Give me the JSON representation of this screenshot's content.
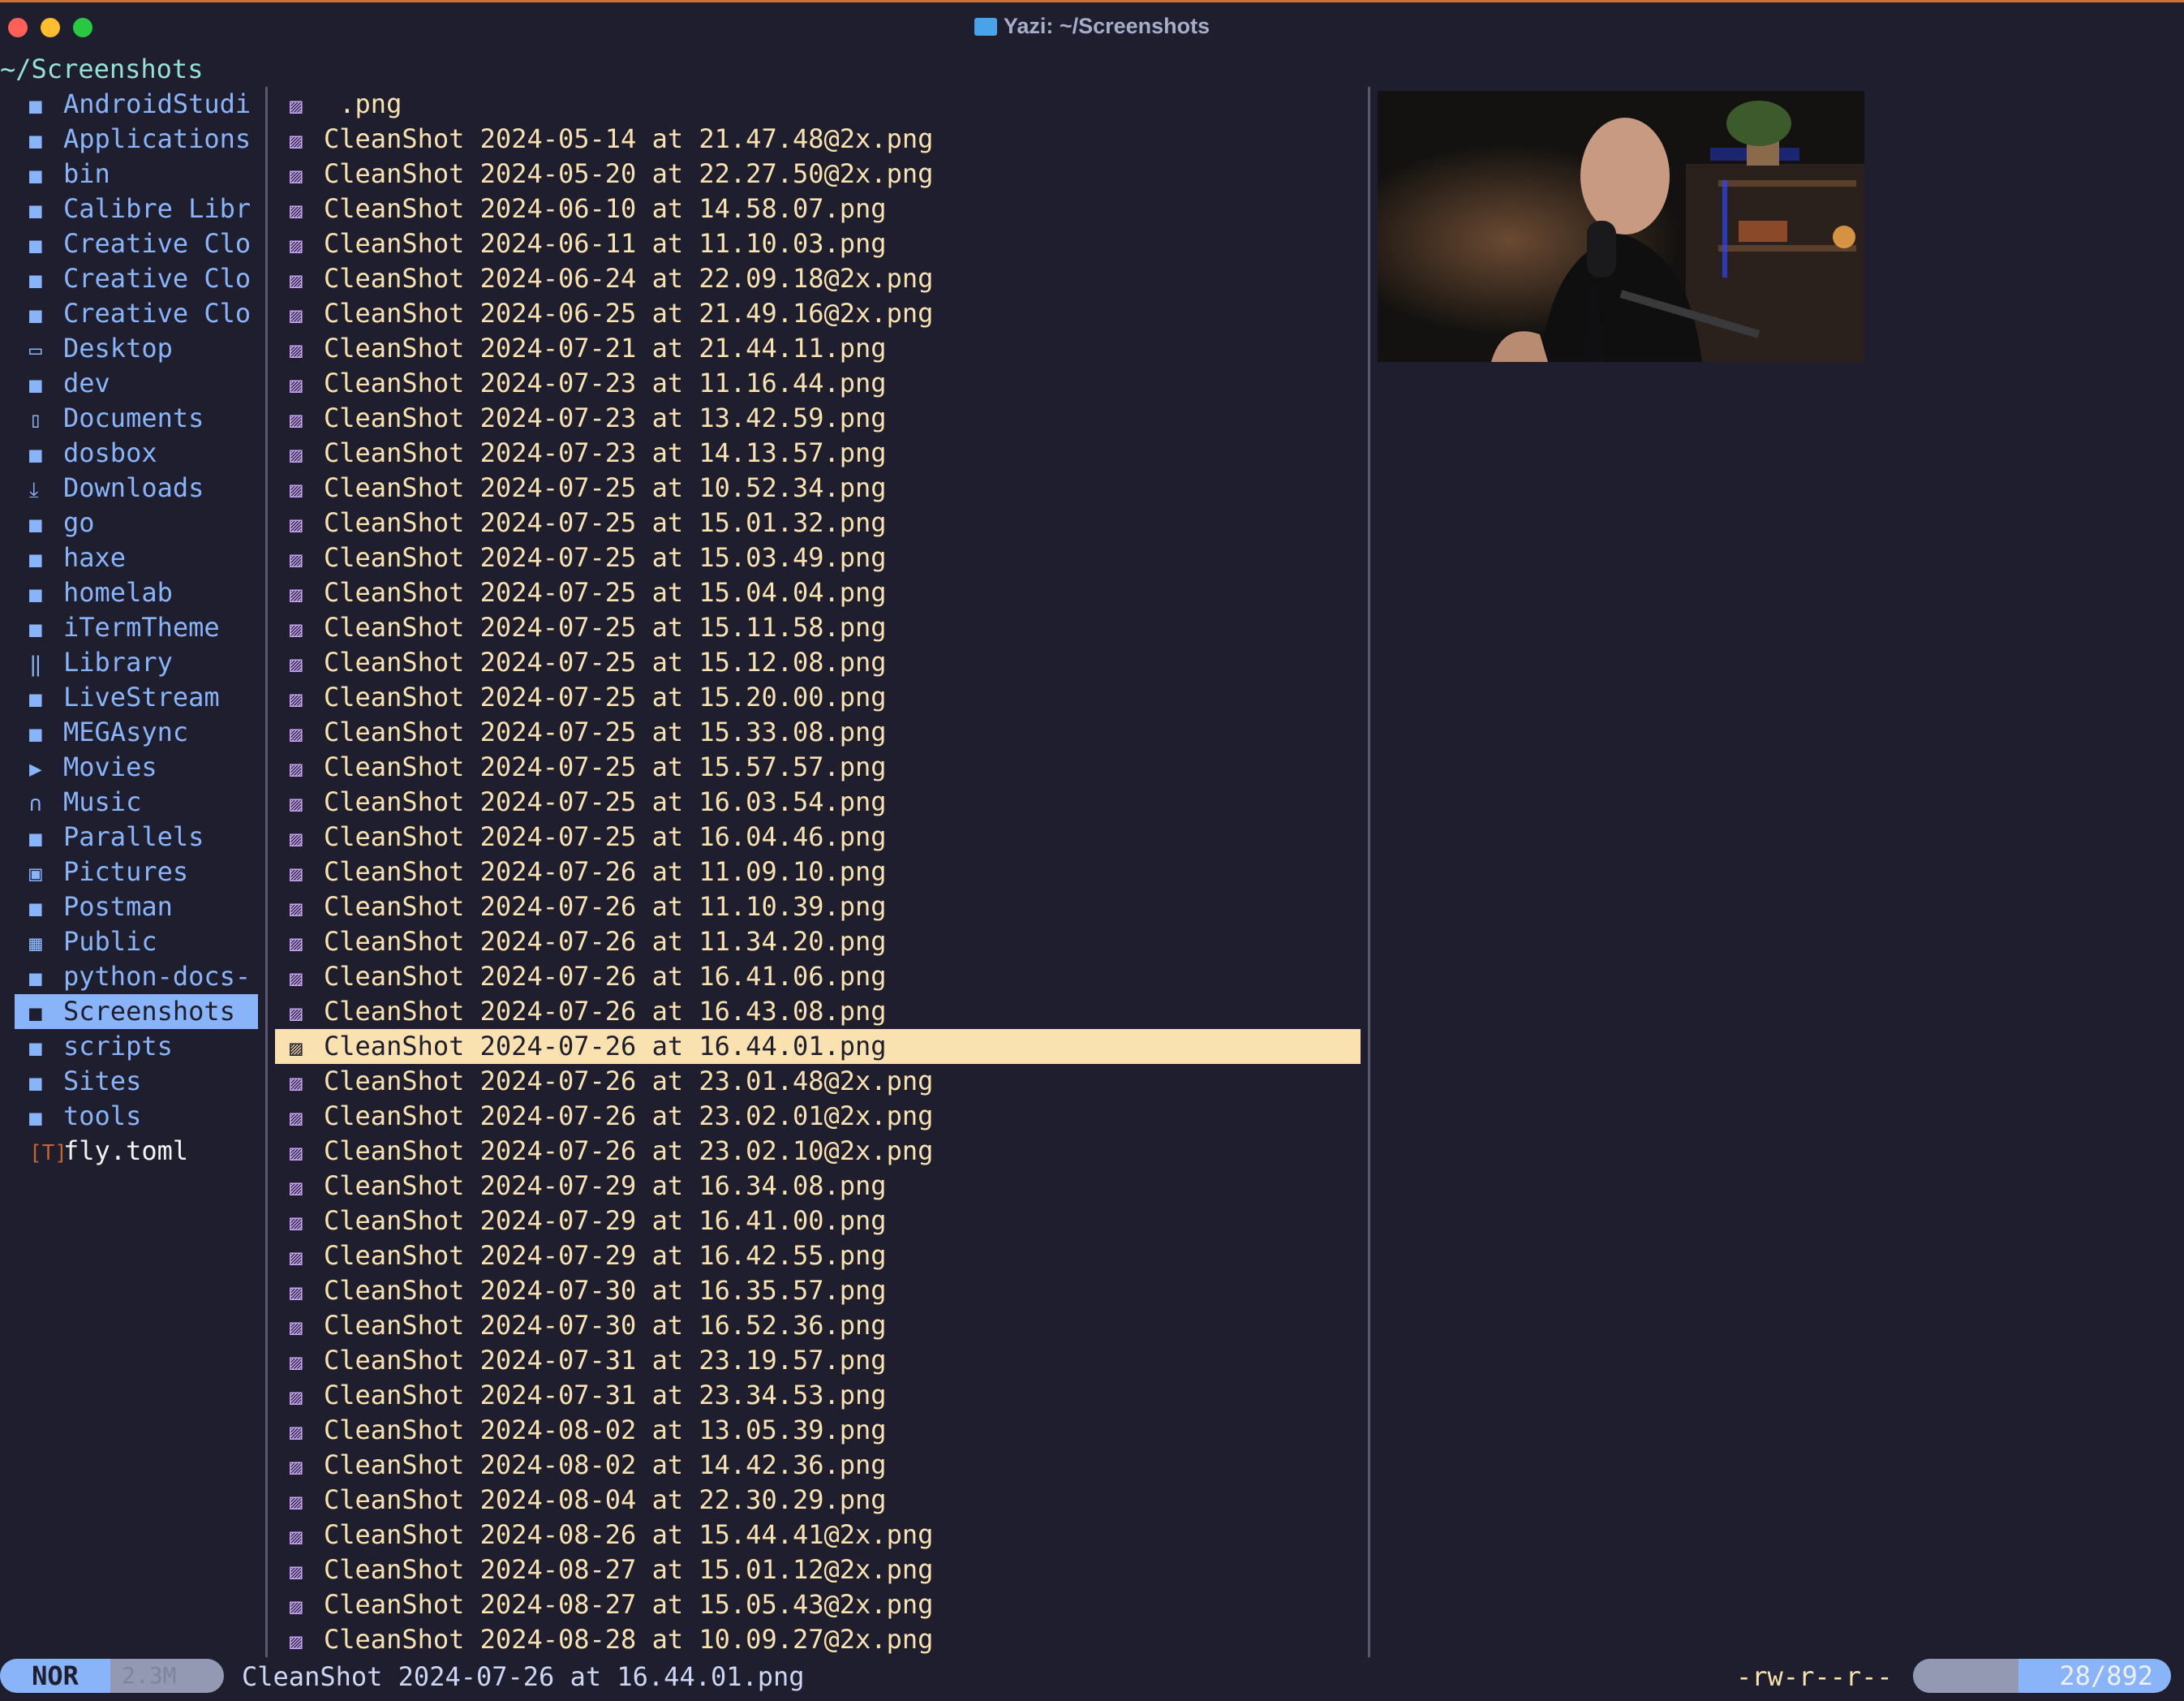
{
  "window": {
    "title": "Yazi: ~/Screenshots"
  },
  "cwd": "~/Screenshots",
  "sidebar": {
    "items": [
      {
        "label": "AndroidStudi",
        "icon": "folder-icon"
      },
      {
        "label": "Applications",
        "icon": "folder-icon"
      },
      {
        "label": "bin",
        "icon": "folder-icon"
      },
      {
        "label": "Calibre Libr",
        "icon": "folder-icon"
      },
      {
        "label": "Creative Clo",
        "icon": "folder-icon"
      },
      {
        "label": "Creative Clo",
        "icon": "folder-icon"
      },
      {
        "label": "Creative Clo",
        "icon": "folder-icon"
      },
      {
        "label": "Desktop",
        "icon": "desktop-icon"
      },
      {
        "label": "dev",
        "icon": "folder-icon"
      },
      {
        "label": "Documents",
        "icon": "documents-icon"
      },
      {
        "label": "dosbox",
        "icon": "folder-icon"
      },
      {
        "label": "Downloads",
        "icon": "downloads-icon"
      },
      {
        "label": "go",
        "icon": "folder-icon"
      },
      {
        "label": "haxe",
        "icon": "folder-icon"
      },
      {
        "label": "homelab",
        "icon": "folder-icon"
      },
      {
        "label": "iTermTheme",
        "icon": "folder-icon"
      },
      {
        "label": "Library",
        "icon": "library-icon"
      },
      {
        "label": "LiveStream",
        "icon": "folder-icon"
      },
      {
        "label": "MEGAsync",
        "icon": "folder-icon"
      },
      {
        "label": "Movies",
        "icon": "movies-icon"
      },
      {
        "label": "Music",
        "icon": "headphones-icon"
      },
      {
        "label": "Parallels",
        "icon": "folder-icon"
      },
      {
        "label": "Pictures",
        "icon": "pictures-icon"
      },
      {
        "label": "Postman",
        "icon": "folder-icon"
      },
      {
        "label": "Public",
        "icon": "public-icon"
      },
      {
        "label": "python-docs-",
        "icon": "folder-icon"
      },
      {
        "label": "Screenshots",
        "icon": "folder-icon",
        "selected": true
      },
      {
        "label": "scripts",
        "icon": "folder-icon"
      },
      {
        "label": "Sites",
        "icon": "folder-icon"
      },
      {
        "label": "tools",
        "icon": "folder-icon"
      },
      {
        "label": "fly.toml",
        "icon": "toml-file-icon",
        "file": true
      }
    ]
  },
  "files": {
    "selected_index": 27,
    "items": [
      " .png",
      "CleanShot 2024-05-14 at 21.47.48@2x.png",
      "CleanShot 2024-05-20 at 22.27.50@2x.png",
      "CleanShot 2024-06-10 at 14.58.07.png",
      "CleanShot 2024-06-11 at 11.10.03.png",
      "CleanShot 2024-06-24 at 22.09.18@2x.png",
      "CleanShot 2024-06-25 at 21.49.16@2x.png",
      "CleanShot 2024-07-21 at 21.44.11.png",
      "CleanShot 2024-07-23 at 11.16.44.png",
      "CleanShot 2024-07-23 at 13.42.59.png",
      "CleanShot 2024-07-23 at 14.13.57.png",
      "CleanShot 2024-07-25 at 10.52.34.png",
      "CleanShot 2024-07-25 at 15.01.32.png",
      "CleanShot 2024-07-25 at 15.03.49.png",
      "CleanShot 2024-07-25 at 15.04.04.png",
      "CleanShot 2024-07-25 at 15.11.58.png",
      "CleanShot 2024-07-25 at 15.12.08.png",
      "CleanShot 2024-07-25 at 15.20.00.png",
      "CleanShot 2024-07-25 at 15.33.08.png",
      "CleanShot 2024-07-25 at 15.57.57.png",
      "CleanShot 2024-07-25 at 16.03.54.png",
      "CleanShot 2024-07-25 at 16.04.46.png",
      "CleanShot 2024-07-26 at 11.09.10.png",
      "CleanShot 2024-07-26 at 11.10.39.png",
      "CleanShot 2024-07-26 at 11.34.20.png",
      "CleanShot 2024-07-26 at 16.41.06.png",
      "CleanShot 2024-07-26 at 16.43.08.png",
      "CleanShot 2024-07-26 at 16.44.01.png",
      "CleanShot 2024-07-26 at 23.01.48@2x.png",
      "CleanShot 2024-07-26 at 23.02.01@2x.png",
      "CleanShot 2024-07-26 at 23.02.10@2x.png",
      "CleanShot 2024-07-29 at 16.34.08.png",
      "CleanShot 2024-07-29 at 16.41.00.png",
      "CleanShot 2024-07-29 at 16.42.55.png",
      "CleanShot 2024-07-30 at 16.35.57.png",
      "CleanShot 2024-07-30 at 16.52.36.png",
      "CleanShot 2024-07-31 at 23.19.57.png",
      "CleanShot 2024-07-31 at 23.34.53.png",
      "CleanShot 2024-08-02 at 13.05.39.png",
      "CleanShot 2024-08-02 at 14.42.36.png",
      "CleanShot 2024-08-04 at 22.30.29.png",
      "CleanShot 2024-08-26 at 15.44.41@2x.png",
      "CleanShot 2024-08-27 at 15.01.12@2x.png",
      "CleanShot 2024-08-27 at 15.05.43@2x.png",
      "CleanShot 2024-08-28 at 10.09.27@2x.png"
    ]
  },
  "status": {
    "mode": "NOR",
    "mode_extra": "2.3M",
    "filename": "CleanShot 2024-07-26 at 16.44.01.png",
    "permissions": "-rw-r--r--",
    "position_extra": "3%",
    "position": "28/892"
  },
  "colors": {
    "background": "#1e1e2e",
    "directory": "#89b4fa",
    "file": "#f9e2af",
    "image_icon": "#cba6f7",
    "cwd": "#94e2d5"
  }
}
